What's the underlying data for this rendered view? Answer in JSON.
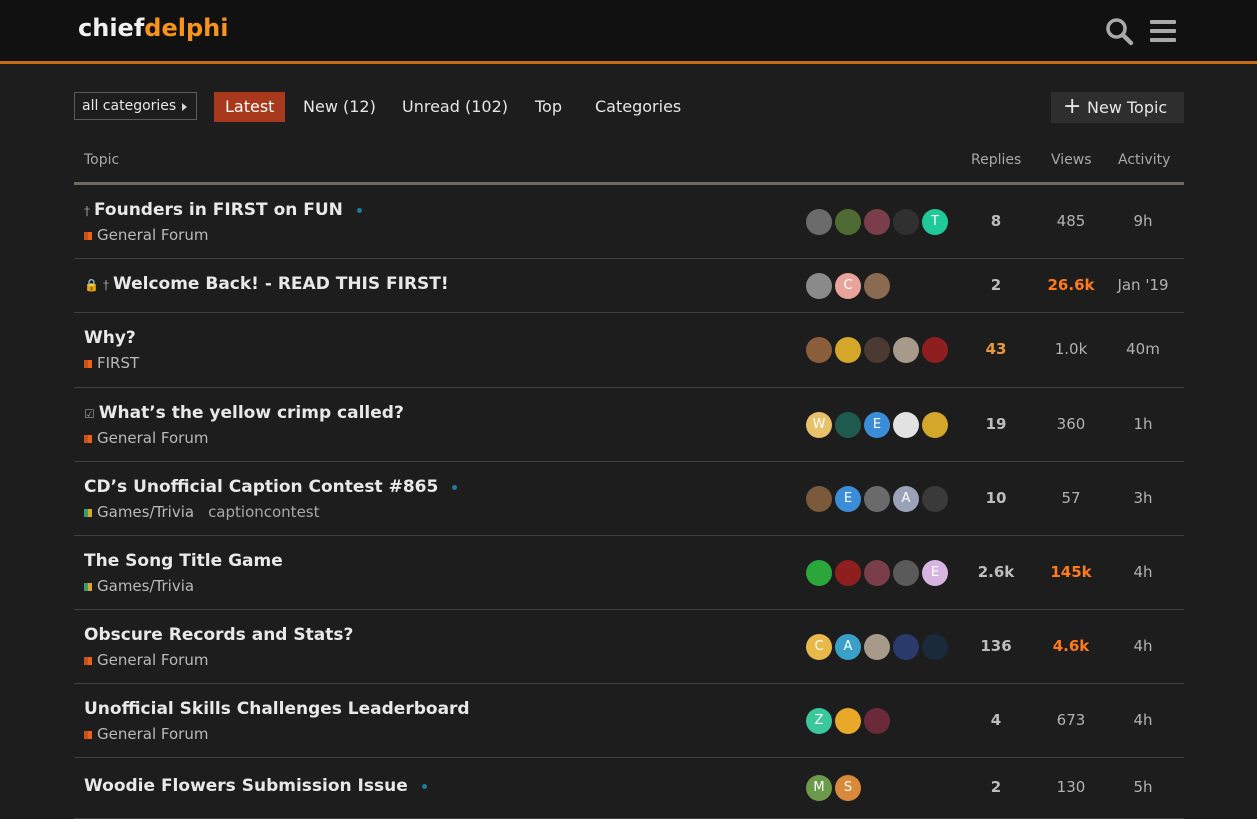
{
  "header": {
    "logo_part1": "chief",
    "logo_part2": "delphi",
    "search_icon": "search-icon",
    "menu_icon": "hamburger-menu-icon"
  },
  "nav": {
    "category_dropdown": "all categories",
    "tabs": [
      {
        "label": "Latest",
        "active": true
      },
      {
        "label": "New (12)",
        "active": false
      },
      {
        "label": "Unread (102)",
        "active": false
      },
      {
        "label": "Top",
        "active": false
      },
      {
        "label": "Categories",
        "active": false
      }
    ],
    "new_topic_label": "New Topic"
  },
  "table": {
    "headers": {
      "topic": "Topic",
      "replies": "Replies",
      "views": "Views",
      "activity": "Activity"
    },
    "rows": [
      {
        "title": "Founders in FIRST on FUN",
        "icons": [
          "pin-icon"
        ],
        "category": "General Forum",
        "category_color": "#c8521c",
        "tag": "",
        "unread_dot": true,
        "posters": [
          {
            "letter": "",
            "color": "#6b6b6b"
          },
          {
            "letter": "",
            "color": "#4f6b34"
          },
          {
            "letter": "",
            "color": "#7a3d4a"
          },
          {
            "letter": "",
            "color": "#303030"
          },
          {
            "letter": "T",
            "color": "#20c99a"
          }
        ],
        "replies": "8",
        "views": "485",
        "activity": "9h",
        "replies_hot": false,
        "views_hot": false
      },
      {
        "title": "Welcome Back! - READ THIS FIRST!",
        "icons": [
          "lock-icon",
          "pin-icon"
        ],
        "category": "",
        "category_color": "",
        "tag": "",
        "unread_dot": false,
        "posters": [
          {
            "letter": "",
            "color": "#8a8a8a"
          },
          {
            "letter": "C",
            "color": "#e8a49a"
          },
          {
            "letter": "",
            "color": "#8b6a52"
          }
        ],
        "replies": "2",
        "views": "26.6k",
        "activity": "Jan '19",
        "replies_hot": false,
        "views_hot": true
      },
      {
        "title": "Why?",
        "icons": [],
        "category": "FIRST",
        "category_color": "#c8521c",
        "tag": "",
        "unread_dot": false,
        "posters": [
          {
            "letter": "",
            "color": "#8a5d3b"
          },
          {
            "letter": "",
            "color": "#d4a72a"
          },
          {
            "letter": "",
            "color": "#4a3a32"
          },
          {
            "letter": "",
            "color": "#a89a8a"
          },
          {
            "letter": "",
            "color": "#8f1f1f"
          }
        ],
        "replies": "43",
        "views": "1.0k",
        "activity": "40m",
        "replies_hot": true,
        "views_hot": false
      },
      {
        "title": "What’s the yellow crimp called?",
        "icons": [
          "checkbox-icon"
        ],
        "category": "General Forum",
        "category_color": "#c8521c",
        "tag": "",
        "unread_dot": false,
        "posters": [
          {
            "letter": "W",
            "color": "#e8c26a"
          },
          {
            "letter": "",
            "color": "#1f5a4f"
          },
          {
            "letter": "E",
            "color": "#3a8dd6"
          },
          {
            "letter": "",
            "color": "#e2e2e2"
          },
          {
            "letter": "",
            "color": "#d4a72a"
          }
        ],
        "replies": "19",
        "views": "360",
        "activity": "1h",
        "replies_hot": false,
        "views_hot": false
      },
      {
        "title": "CD’s Unofficial Caption Contest #865",
        "icons": [],
        "category": "Games/Trivia",
        "category_color": "#3a9a6a",
        "tag": "captioncontest",
        "unread_dot": true,
        "posters": [
          {
            "letter": "",
            "color": "#7a5a3a"
          },
          {
            "letter": "E",
            "color": "#3a8dd6"
          },
          {
            "letter": "",
            "color": "#6a6a6a"
          },
          {
            "letter": "A",
            "color": "#9aa2b8"
          },
          {
            "letter": "",
            "color": "#3a3a3a"
          }
        ],
        "replies": "10",
        "views": "57",
        "activity": "3h",
        "replies_hot": false,
        "views_hot": false
      },
      {
        "title": "The Song Title Game",
        "icons": [],
        "category": "Games/Trivia",
        "category_color": "#3a9a6a",
        "tag": "",
        "unread_dot": false,
        "posters": [
          {
            "letter": "",
            "color": "#2aa63a"
          },
          {
            "letter": "",
            "color": "#8f1f1f"
          },
          {
            "letter": "",
            "color": "#7a3d4a"
          },
          {
            "letter": "",
            "color": "#5a5a5a"
          },
          {
            "letter": "E",
            "color": "#d8b4e0"
          }
        ],
        "replies": "2.6k",
        "views": "145k",
        "activity": "4h",
        "replies_hot": false,
        "views_hot": true
      },
      {
        "title": "Obscure Records and Stats?",
        "icons": [],
        "category": "General Forum",
        "category_color": "#c8521c",
        "tag": "",
        "unread_dot": false,
        "posters": [
          {
            "letter": "C",
            "color": "#e8b84a"
          },
          {
            "letter": "A",
            "color": "#3aa0c8"
          },
          {
            "letter": "",
            "color": "#a89a8a"
          },
          {
            "letter": "",
            "color": "#2a3a6a"
          },
          {
            "letter": "",
            "color": "#1a2a3a"
          }
        ],
        "replies": "136",
        "views": "4.6k",
        "activity": "4h",
        "replies_hot": false,
        "views_hot": true
      },
      {
        "title": "Unofficial Skills Challenges Leaderboard",
        "icons": [],
        "category": "General Forum",
        "category_color": "#c8521c",
        "tag": "",
        "unread_dot": false,
        "posters": [
          {
            "letter": "Z",
            "color": "#3ac89a"
          },
          {
            "letter": "",
            "color": "#e8a82a"
          },
          {
            "letter": "",
            "color": "#6a2a3a"
          }
        ],
        "replies": "4",
        "views": "673",
        "activity": "4h",
        "replies_hot": false,
        "views_hot": false
      },
      {
        "title": "Woodie Flowers Submission Issue",
        "icons": [],
        "category": "",
        "category_color": "",
        "tag": "",
        "unread_dot": true,
        "posters": [
          {
            "letter": "M",
            "color": "#6a9a4a"
          },
          {
            "letter": "S",
            "color": "#d88a3a"
          }
        ],
        "replies": "2",
        "views": "130",
        "activity": "5h",
        "replies_hot": false,
        "views_hot": false
      }
    ]
  }
}
